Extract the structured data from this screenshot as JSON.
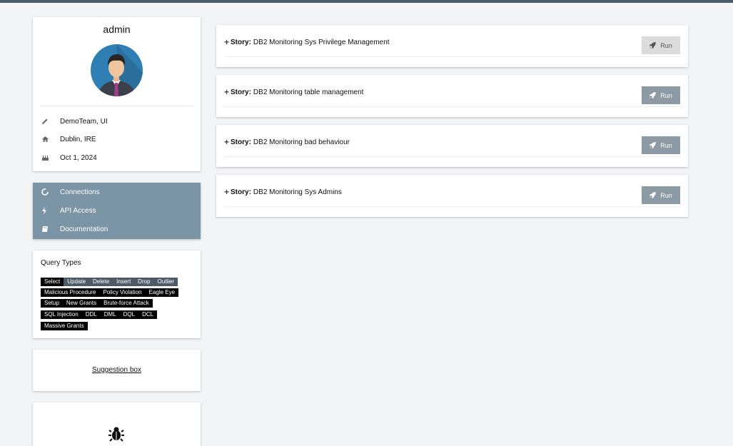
{
  "profile": {
    "name": "admin",
    "team": "DemoTeam, UI",
    "location": "Dublin, IRE",
    "date": "Oct 1, 2024"
  },
  "nav": {
    "items": [
      {
        "label": "Connections",
        "icon": "circle-notch-icon"
      },
      {
        "label": "API Access",
        "icon": "bolt-icon"
      },
      {
        "label": "Documentation",
        "icon": "book-icon"
      }
    ]
  },
  "query_types": {
    "title": "Query Types",
    "tags": [
      "Select",
      "Update",
      "Delete",
      "Insert",
      "Drop",
      "Outlier",
      "Malicious Procedure",
      "Policy Violation",
      "Eagle Eye",
      "Setup",
      "New Grants",
      "Brute-force Attack",
      "SQL Injection",
      "DDL",
      "DML",
      "DQL",
      "DCL",
      "Massive Grants"
    ]
  },
  "suggestion": {
    "label": "Suggestion box"
  },
  "stories": {
    "prefix": "Story:",
    "run_label": "Run",
    "items": [
      {
        "title": "DB2 Monitoring Sys Privilege Management",
        "disabled": true
      },
      {
        "title": "DB2 Monitoring table management",
        "disabled": false
      },
      {
        "title": "DB2 Monitoring bad behaviour",
        "disabled": false
      },
      {
        "title": "DB2 Monitoring Sys Admins",
        "disabled": false
      }
    ]
  },
  "colors": {
    "topbar": "#4d5b68",
    "nav_bg": "#7b95a7",
    "run_button": "#8c9aa4",
    "run_button_disabled": "#dcdcdc",
    "tag_selected": "#000000",
    "tag_highlight": "#4d5b68"
  }
}
